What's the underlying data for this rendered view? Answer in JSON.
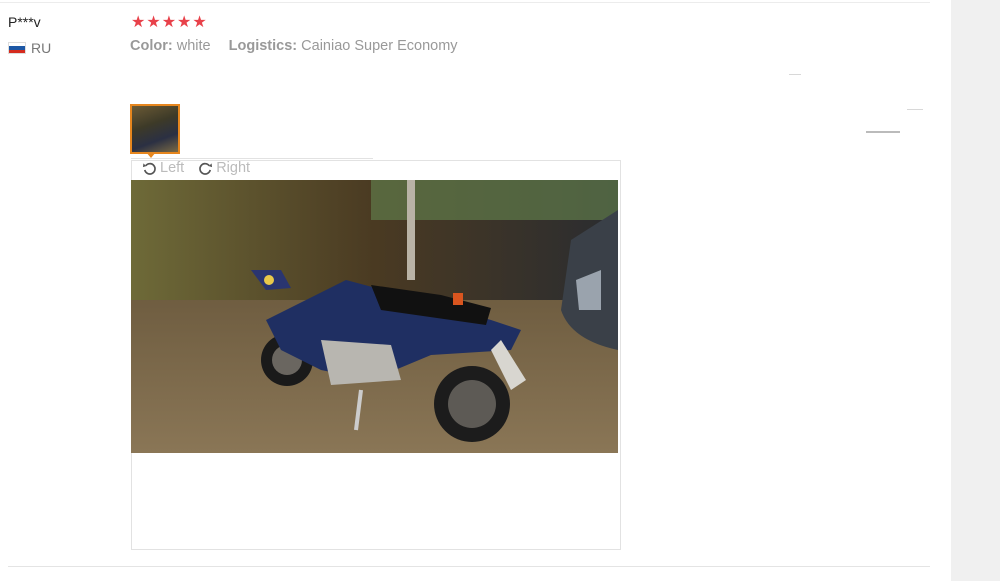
{
  "review": {
    "user": "P***v",
    "country_code": "RU",
    "rating": 5,
    "attributes": [
      {
        "label": "Color:",
        "value": "white"
      },
      {
        "label": "Logistics:",
        "value": "Cainiao Super Economy"
      }
    ]
  },
  "viewer": {
    "rotate_left_label": "Left",
    "rotate_right_label": "Right"
  },
  "colors": {
    "star": "#e8414a",
    "thumb_border": "#e6861e",
    "gutter": "#f0f0f0"
  }
}
